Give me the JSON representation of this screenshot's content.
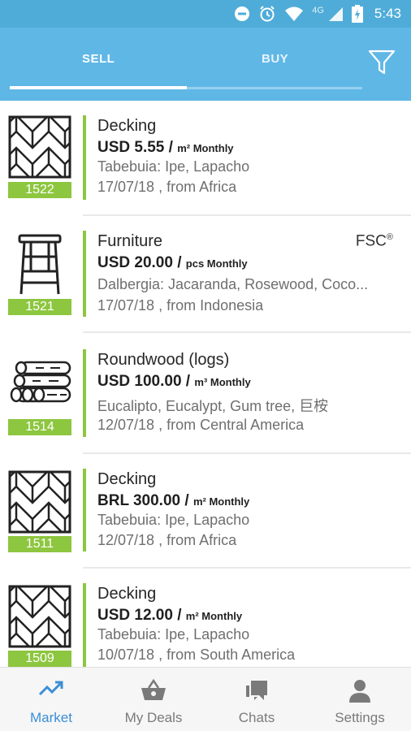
{
  "status_bar": {
    "network": "4G",
    "time": "5:43"
  },
  "tabs": [
    {
      "label": "SELL",
      "active": true
    },
    {
      "label": "BUY",
      "active": false
    }
  ],
  "listings": [
    {
      "id": "1522",
      "icon": "parquet-icon",
      "category": "Decking",
      "price": "USD 5.55 /",
      "unit": "m² Monthly",
      "species": "Tabebuia: Ipe, Lapacho",
      "date_origin": "17/07/18 , from Africa",
      "certification": ""
    },
    {
      "id": "1521",
      "icon": "stool-icon",
      "category": "Furniture",
      "price": "USD 20.00 /",
      "unit": "pcs Monthly",
      "species": "Dalbergia: Jacaranda, Rosewood, Coco...",
      "date_origin": "17/07/18 , from Indonesia",
      "certification": "FSC",
      "certification_mark": "®"
    },
    {
      "id": "1514",
      "icon": "logs-icon",
      "category": "Roundwood (logs)",
      "price": "USD 100.00 /",
      "unit": "m³ Monthly",
      "species": "Eucalipto, Eucalypt, Gum tree, 巨桉",
      "date_origin": "12/07/18 , from Central America",
      "certification": ""
    },
    {
      "id": "1511",
      "icon": "parquet-icon",
      "category": "Decking",
      "price": "BRL 300.00 /",
      "unit": "m² Monthly",
      "species": "Tabebuia: Ipe, Lapacho",
      "date_origin": "12/07/18 , from Africa",
      "certification": ""
    },
    {
      "id": "1509",
      "icon": "parquet-icon",
      "category": "Decking",
      "price": "USD 12.00 /",
      "unit": "m² Monthly",
      "species": "Tabebuia: Ipe, Lapacho",
      "date_origin": "10/07/18 , from South America",
      "certification": ""
    }
  ],
  "bottom_nav": [
    {
      "label": "Market",
      "icon": "trending-up-icon",
      "active": true
    },
    {
      "label": "My Deals",
      "icon": "basket-icon",
      "active": false
    },
    {
      "label": "Chats",
      "icon": "chat-icon",
      "active": false
    },
    {
      "label": "Settings",
      "icon": "person-icon",
      "active": false
    }
  ],
  "colors": {
    "header": "#5fb7e6",
    "status_bar": "#4facd8",
    "accent_green": "#8dc63f",
    "active_nav": "#3b8fd6"
  }
}
